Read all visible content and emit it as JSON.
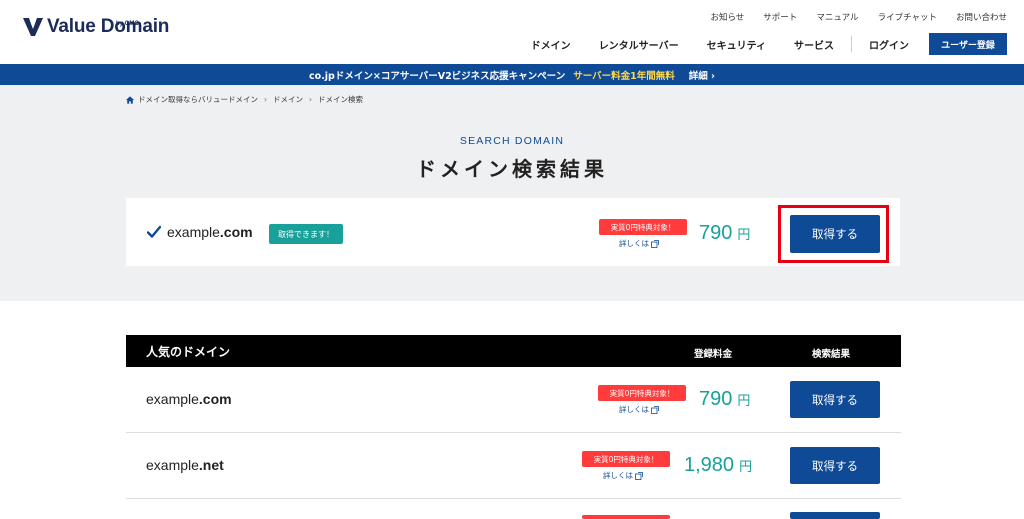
{
  "header": {
    "logo_text": "Value Domain",
    "logo_sub": "by GMO",
    "util_nav": [
      "お知らせ",
      "サポート",
      "マニュアル",
      "ライブチャット",
      "お問い合わせ"
    ],
    "main_nav": [
      "ドメイン",
      "レンタルサーバー",
      "セキュリティ",
      "サービス"
    ],
    "login": "ログイン",
    "register": "ユーザー登録"
  },
  "banner": {
    "text": "co.jpドメイン×コアサーバーV2ビジネス応援キャンペーン",
    "highlight": "サーバー料金1年間無料",
    "more": "詳細 ›"
  },
  "breadcrumb": [
    "ドメイン取得ならバリュードメイン",
    "ドメイン",
    "ドメイン検索"
  ],
  "search": {
    "subtitle": "SEARCH DOMAIN",
    "title": "ドメイン検索結果"
  },
  "result": {
    "name": "example",
    "tld": ".com",
    "status": "取得できます！",
    "promo": "実質0円特典対象！",
    "promo_link": "詳しくは",
    "price": "790",
    "unit": "円",
    "button": "取得する"
  },
  "popular": {
    "title": "人気のドメイン",
    "col_fee": "登録料金",
    "col_result": "検索結果",
    "rows": [
      {
        "name": "example",
        "tld": ".com",
        "promo": "実質0円特典対象！",
        "promo_link": "詳しくは",
        "price": "790",
        "unit": "円",
        "button": "取得する"
      },
      {
        "name": "example",
        "tld": ".net",
        "promo": "実質0円特典対象！",
        "promo_link": "詳しくは",
        "price": "1,980",
        "unit": "円",
        "button": "取得する"
      }
    ]
  },
  "colors": {
    "brand": "#0f4a96",
    "teal": "#17a19a",
    "promo_red": "#ff3b3b",
    "highlight_red": "#e60012"
  }
}
